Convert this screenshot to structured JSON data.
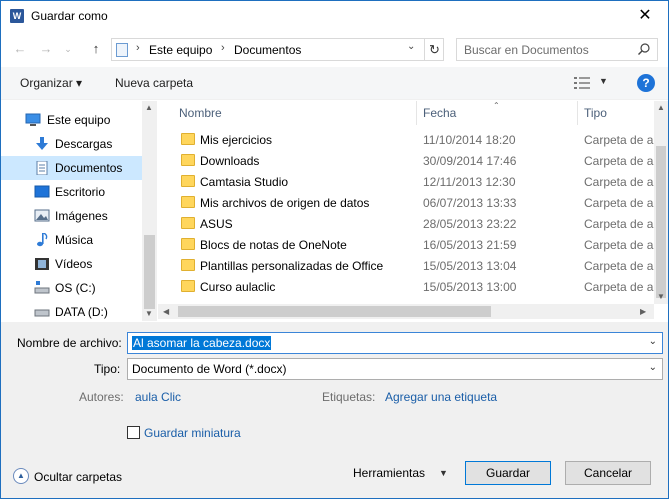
{
  "window": {
    "title": "Guardar como",
    "app_icon_letter": "W",
    "close_glyph": "✕"
  },
  "address_bar": {
    "path": [
      "Este equipo",
      "Documentos"
    ],
    "separator": "›",
    "search_placeholder": "Buscar en Documentos"
  },
  "toolbar": {
    "organize_label": "Organizar ▾",
    "new_folder_label": "Nueva carpeta",
    "help_label": "?"
  },
  "nav_pane": {
    "items": [
      {
        "label": "Este equipo",
        "icon": "computer-icon"
      },
      {
        "label": "Descargas",
        "icon": "download-icon"
      },
      {
        "label": "Documentos",
        "icon": "document-icon",
        "selected": true
      },
      {
        "label": "Escritorio",
        "icon": "desktop-icon"
      },
      {
        "label": "Imágenes",
        "icon": "pictures-icon"
      },
      {
        "label": "Música",
        "icon": "music-icon"
      },
      {
        "label": "Vídeos",
        "icon": "video-icon"
      },
      {
        "label": "OS (C:)",
        "icon": "drive-icon"
      },
      {
        "label": "DATA (D:)",
        "icon": "drive-icon"
      }
    ]
  },
  "file_list": {
    "columns": {
      "name": "Nombre",
      "date": "Fecha",
      "type": "Tipo"
    },
    "rows": [
      {
        "name": "Mis ejercicios",
        "date": "11/10/2014 18:20",
        "type": "Carpeta de archivos"
      },
      {
        "name": "Downloads",
        "date": "30/09/2014 17:46",
        "type": "Carpeta de archivos"
      },
      {
        "name": "Camtasia Studio",
        "date": "12/11/2013 12:30",
        "type": "Carpeta de archivos"
      },
      {
        "name": "Mis archivos de origen de datos",
        "date": "06/07/2013 13:33",
        "type": "Carpeta de archivos"
      },
      {
        "name": "ASUS",
        "date": "28/05/2013 23:22",
        "type": "Carpeta de archivos"
      },
      {
        "name": "Blocs de notas de OneNote",
        "date": "16/05/2013 21:59",
        "type": "Carpeta de archivos"
      },
      {
        "name": "Plantillas personalizadas de Office",
        "date": "15/05/2013 13:04",
        "type": "Carpeta de archivos"
      },
      {
        "name": "Curso aulaclic",
        "date": "15/05/2013 13:00",
        "type": "Carpeta de archivos"
      }
    ]
  },
  "form": {
    "filename_label": "Nombre de archivo:",
    "filename_value": "Al asomar la cabeza.docx",
    "type_label": "Tipo:",
    "type_value": "Documento de Word (*.docx)",
    "authors_label": "Autores:",
    "authors_value": "aula Clic",
    "tags_label": "Etiquetas:",
    "tags_value": "Agregar una etiqueta",
    "thumbnail_label": "Guardar miniatura"
  },
  "footer": {
    "hide_folders_label": "Ocultar carpetas",
    "tools_label": "Herramientas",
    "save_label": "Guardar",
    "cancel_label": "Cancelar"
  }
}
